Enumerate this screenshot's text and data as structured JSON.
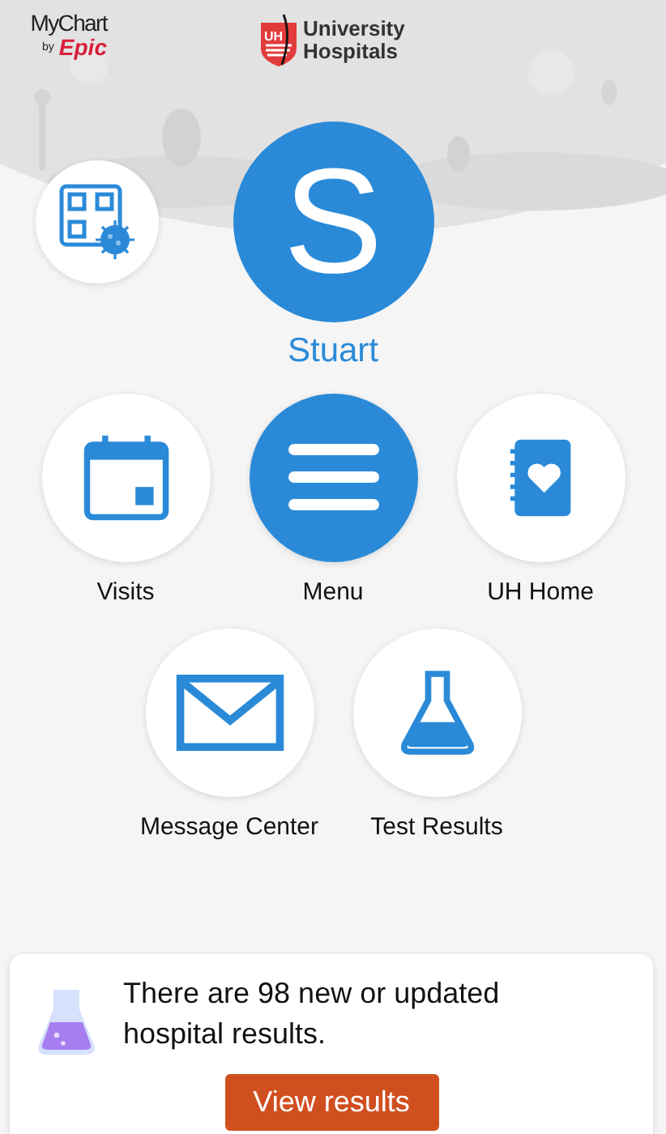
{
  "header": {
    "mychart_logo": {
      "name": "MyChart",
      "by": "by",
      "brand": "Epic"
    },
    "hospital_logo": {
      "mark": "UH",
      "line_1": "University",
      "line_2": "Hospitals"
    }
  },
  "profile": {
    "initial": "S",
    "name": "Stuart"
  },
  "tiles": [
    {
      "kind": "calendar",
      "label": "Visits",
      "filled": false
    },
    {
      "kind": "menu",
      "label": "Menu",
      "filled": true
    },
    {
      "kind": "notebook",
      "label": "UH Home",
      "filled": false
    },
    {
      "kind": "envelope",
      "label": "Message Center",
      "filled": false
    },
    {
      "kind": "flask",
      "label": "Test Results",
      "filled": false
    }
  ],
  "notice": {
    "text": "There are 98 new or updated hospital results.",
    "button": "View results"
  }
}
